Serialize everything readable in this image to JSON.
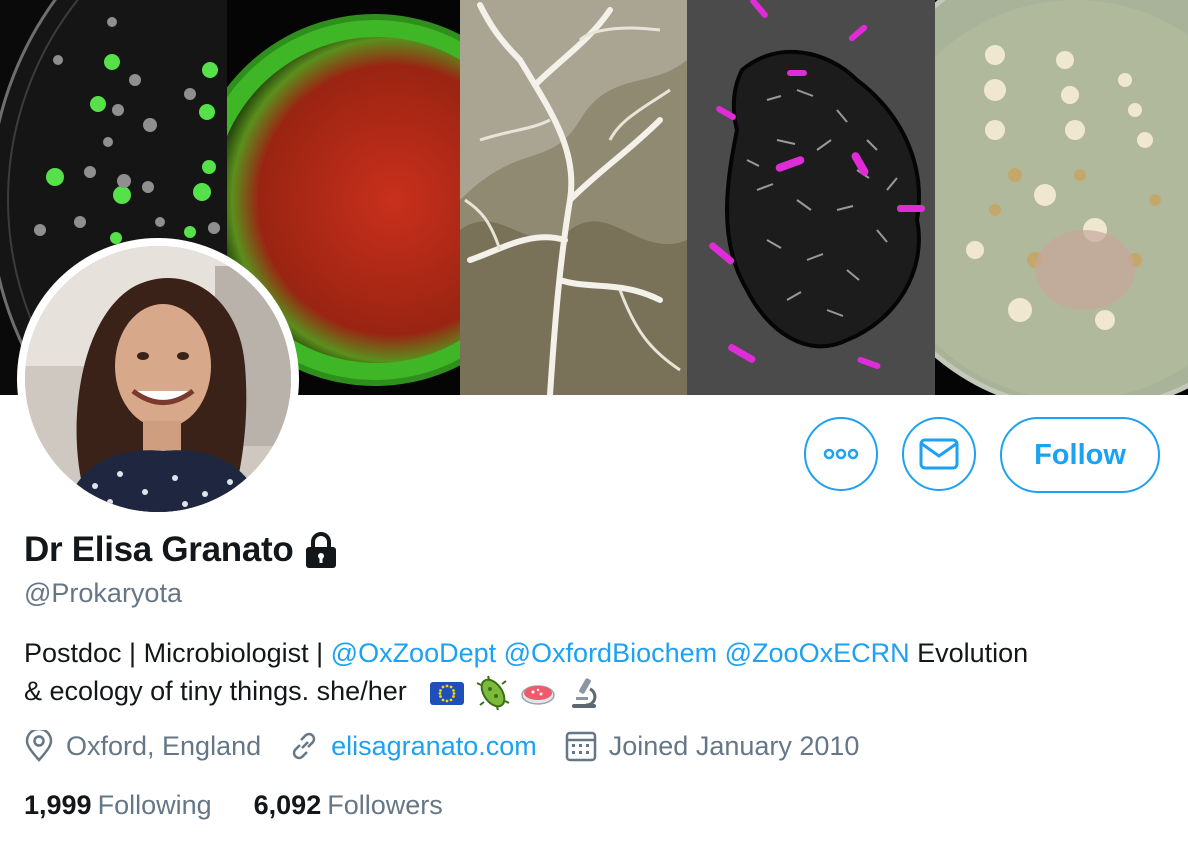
{
  "profile": {
    "name": "Dr Elisa Granato",
    "handle": "@Prokaryota",
    "bio": {
      "prefix": "Postdoc | Microbiologist | ",
      "mentions": [
        "@OxZooDept",
        "@OxfordBiochem",
        "@ZooOxECRN"
      ],
      "suffix_line1": " Evolution",
      "line2": "& ecology of tiny things. she/her",
      "emoji_icons": [
        "eu-flag-icon",
        "microbe-icon",
        "petri-dish-icon",
        "microscope-icon"
      ]
    },
    "location": "Oxford, England",
    "website": "elisagranato.com",
    "joined": "Joined January 2010"
  },
  "stats": {
    "following_count": "1,999",
    "following_label": "Following",
    "followers_count": "6,092",
    "followers_label": "Followers"
  },
  "actions": {
    "follow_label": "Follow",
    "more_icon": "more-icon",
    "message_icon": "envelope-icon"
  },
  "colors": {
    "accent": "#1da1f2",
    "secondary_text": "#657786",
    "primary_text": "#14171a"
  }
}
